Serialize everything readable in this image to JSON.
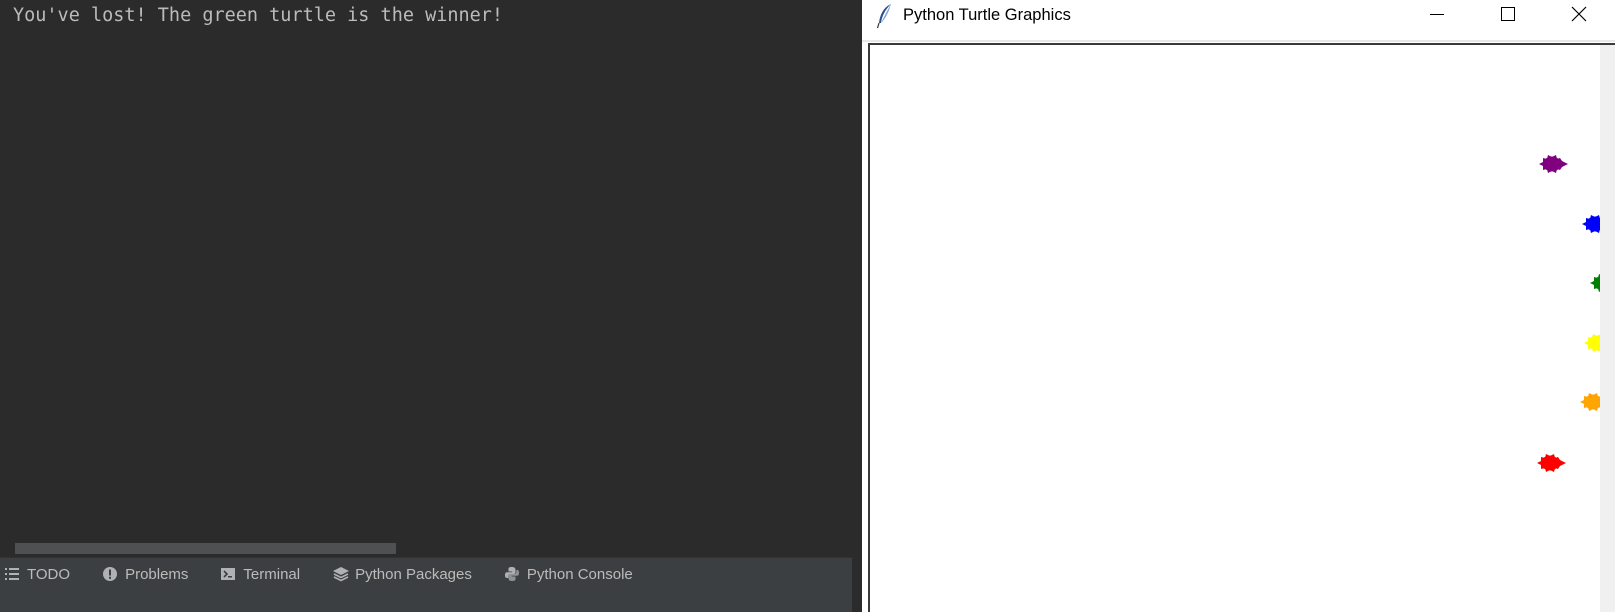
{
  "console": {
    "output_line": "You've lost! The green turtle is the winner!"
  },
  "tool_windows": [
    {
      "label": "TODO",
      "icon": "list-icon"
    },
    {
      "label": "Problems",
      "icon": "exclamation-circle-icon"
    },
    {
      "label": "Terminal",
      "icon": "terminal-icon"
    },
    {
      "label": "Python Packages",
      "icon": "layers-icon"
    },
    {
      "label": "Python Console",
      "icon": "python-icon"
    }
  ],
  "turtle_window": {
    "title": "Python Turtle Graphics",
    "app_icon": "feather-icon",
    "buttons": {
      "minimize": "minimize-icon",
      "maximize": "maximize-icon",
      "close": "close-icon"
    },
    "turtles": [
      {
        "color": "purple",
        "hex": "#800080"
      },
      {
        "color": "blue",
        "hex": "#0000ff"
      },
      {
        "color": "green",
        "hex": "#008000"
      },
      {
        "color": "yellow",
        "hex": "#ffff00"
      },
      {
        "color": "orange",
        "hex": "#ffa500"
      },
      {
        "color": "red",
        "hex": "#ff0000"
      }
    ]
  },
  "colors": {
    "ide_background": "#2b2b2b",
    "ide_text": "#bbbbbb",
    "toolbar_background": "#3c3f41"
  }
}
